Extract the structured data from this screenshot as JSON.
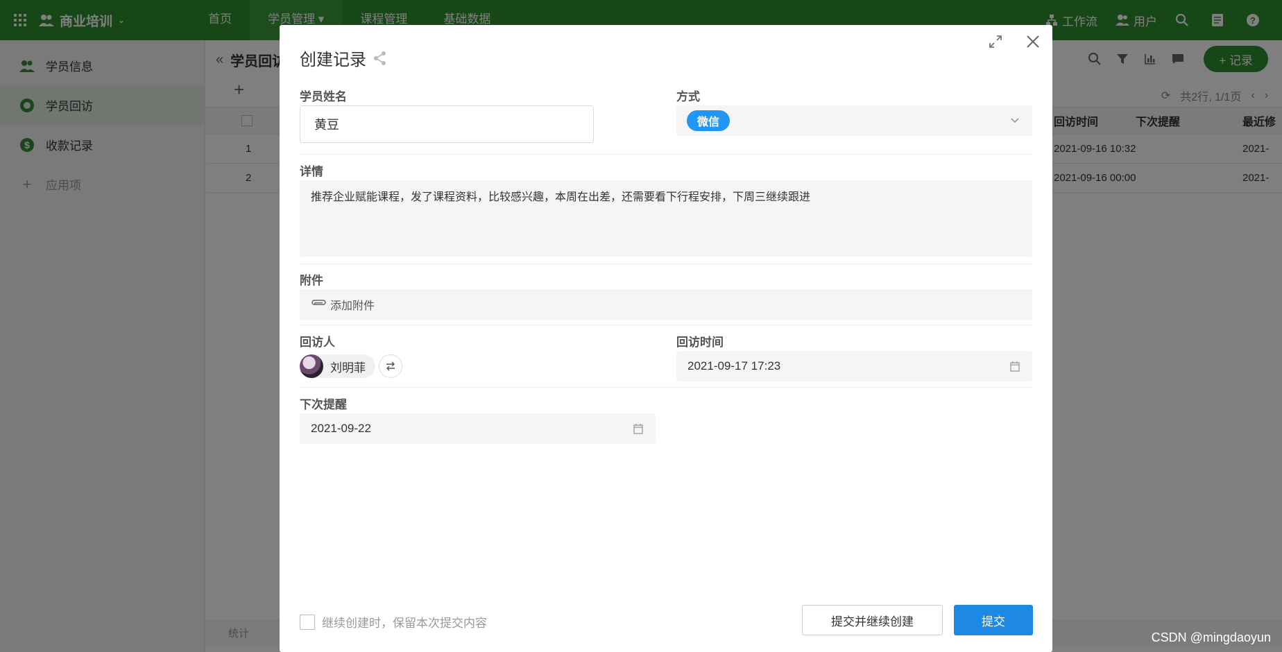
{
  "app": {
    "title": "商业培训",
    "nav": [
      {
        "label": "首页"
      },
      {
        "label": "学员管理 ▾"
      },
      {
        "label": "课程管理"
      },
      {
        "label": "基础数据"
      }
    ],
    "right": {
      "workflow": "工作流",
      "users": "用户"
    }
  },
  "sidebar": {
    "items": [
      {
        "label": "学员信息"
      },
      {
        "label": "学员回访"
      },
      {
        "label": "收款记录"
      },
      {
        "label": "应用项"
      }
    ]
  },
  "main": {
    "title": "学员回访",
    "add_record": "+ 记录",
    "pager": {
      "summary": "共2行, 1/1页"
    },
    "columns": {
      "visit_time": "回访时间",
      "next_reminder": "下次提醒",
      "last_modified": "最近修"
    },
    "rows": [
      {
        "index": "1",
        "visit_time": "2021-09-16 10:32",
        "last_modified": "2021-"
      },
      {
        "index": "2",
        "visit_time": "2021-09-16 00:00",
        "last_modified": "2021-"
      }
    ],
    "stats_label": "统计"
  },
  "modal": {
    "title": "创建记录",
    "fields": {
      "student_name": {
        "label": "学员姓名",
        "value": "黄豆"
      },
      "method": {
        "label": "方式",
        "value": "微信"
      },
      "details": {
        "label": "详情",
        "value": "推荐企业赋能课程，发了课程资料，比较感兴趣，本周在出差，还需要看下行程安排，下周三继续跟进"
      },
      "attachment": {
        "label": "附件",
        "action": "添加附件"
      },
      "visitor": {
        "label": "回访人",
        "value": "刘明菲"
      },
      "visit_time": {
        "label": "回访时间",
        "value": "2021-09-17 17:23"
      },
      "next_reminder": {
        "label": "下次提醒",
        "value": "2021-09-22"
      }
    },
    "footer": {
      "keep_content": "继续创建时，保留本次提交内容",
      "submit_continue": "提交并继续创建",
      "submit": "提交"
    }
  },
  "watermark": "CSDN @mingdaoyun",
  "colors": {
    "brand_green": "#2e8c2e",
    "primary_blue": "#1e88e5",
    "tag_blue": "#2196f3"
  }
}
